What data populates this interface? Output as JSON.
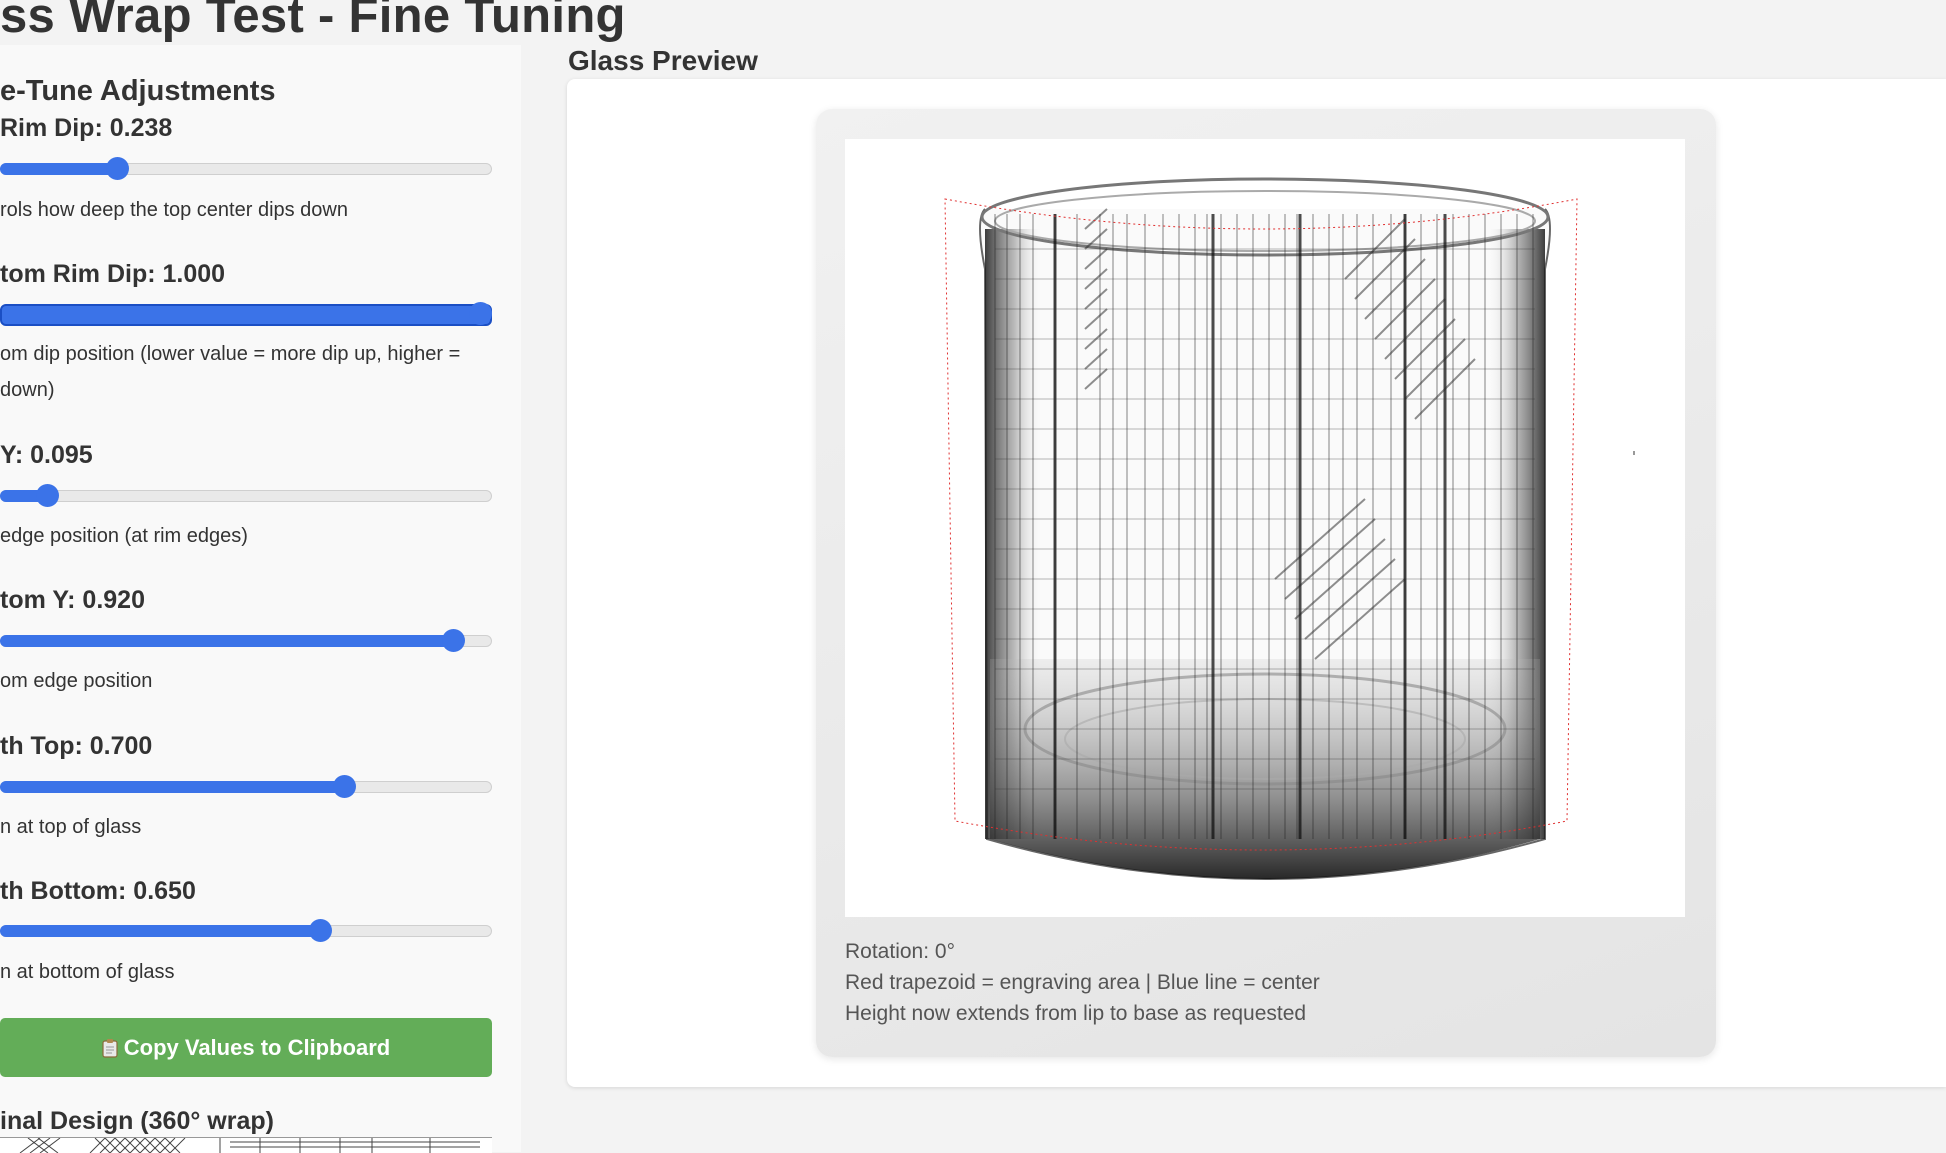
{
  "page": {
    "title": "ss Wrap Test - Fine Tuning"
  },
  "sidebar": {
    "heading": "e-Tune Adjustments",
    "controls": [
      {
        "label": "Rim Dip: 0.238",
        "value": 0.238,
        "description": "rols how deep the top center dips down"
      },
      {
        "label": "tom Rim Dip: 1.000",
        "value": 1.0,
        "description": "om dip position (lower value = more dip up, higher = down)"
      },
      {
        "label": "Y: 0.095",
        "value": 0.095,
        "description": "edge position (at rim edges)"
      },
      {
        "label": "tom Y: 0.920",
        "value": 0.92,
        "description": "om edge position"
      },
      {
        "label": "th Top: 0.700",
        "value": 0.7,
        "description": "n at top of glass"
      },
      {
        "label": "th Bottom: 0.650",
        "value": 0.65,
        "description": "n at bottom of glass"
      }
    ],
    "copy_button": {
      "label": "Copy Values to Clipboard",
      "icon": "clipboard-icon"
    },
    "original_heading": "inal Design (360° wrap)"
  },
  "preview": {
    "heading": "Glass Preview",
    "rotation_text": "Rotation: 0°",
    "legend_text": "Red trapezoid = engraving area | Blue line = center",
    "height_note": "Height now extends from lip to base as requested"
  },
  "colors": {
    "accent": "#3b73e8",
    "button": "#63ad58",
    "engraving_outline": "#e03030"
  }
}
